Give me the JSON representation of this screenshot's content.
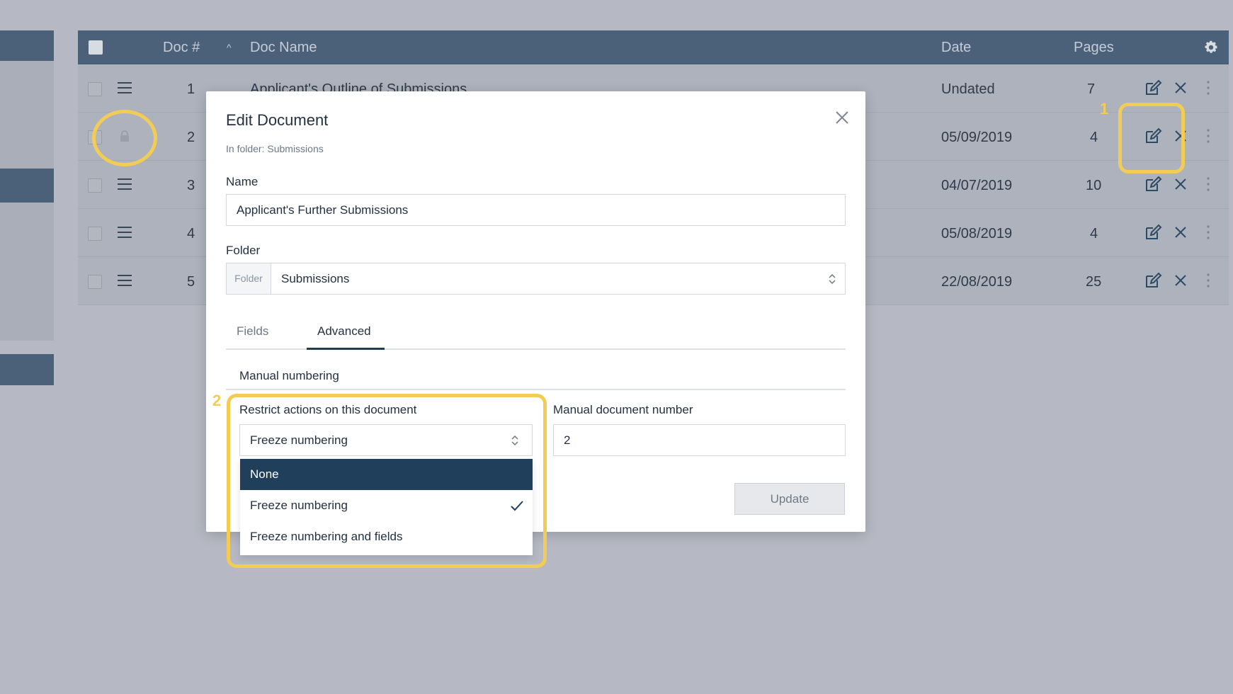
{
  "table": {
    "headers": {
      "doc_num": "Doc #",
      "doc_name": "Doc Name",
      "date": "Date",
      "pages": "Pages"
    },
    "sort_indicator": "^",
    "rows": [
      {
        "num": "1",
        "name": "Applicant's Outline of Submissions",
        "date": "Undated",
        "pages": "7",
        "locked": false
      },
      {
        "num": "2",
        "name": "",
        "date": "05/09/2019",
        "pages": "4",
        "locked": true
      },
      {
        "num": "3",
        "name": "",
        "date": "04/07/2019",
        "pages": "10",
        "locked": false
      },
      {
        "num": "4",
        "name": "",
        "date": "05/08/2019",
        "pages": "4",
        "locked": false
      },
      {
        "num": "5",
        "name": "",
        "date": "22/08/2019",
        "pages": "25",
        "locked": false
      }
    ]
  },
  "modal": {
    "title": "Edit Document",
    "subtitle": "In folder: Submissions",
    "name_label": "Name",
    "name_value": "Applicant's Further Submissions",
    "folder_label": "Folder",
    "folder_prefix": "Folder",
    "folder_value": "Submissions",
    "tabs": [
      "Fields",
      "Advanced"
    ],
    "active_tab": "Advanced",
    "section_title": "Manual numbering",
    "restrict_label": "Restrict actions on this document",
    "restrict_value": "Freeze numbering",
    "manual_number_label": "Manual document number",
    "manual_number_value": "2",
    "update_label": "Update"
  },
  "dropdown": {
    "options": [
      "None",
      "Freeze numbering",
      "Freeze numbering and fields"
    ],
    "highlighted": "None",
    "checked": "Freeze numbering"
  },
  "annotations": {
    "marker_1": "1",
    "marker_2": "2",
    "color": "#f3cc55"
  },
  "colors": {
    "header_bg": "#4b6079",
    "overlay_bg": "#b6b9c3",
    "accent": "#1f3f5b"
  }
}
